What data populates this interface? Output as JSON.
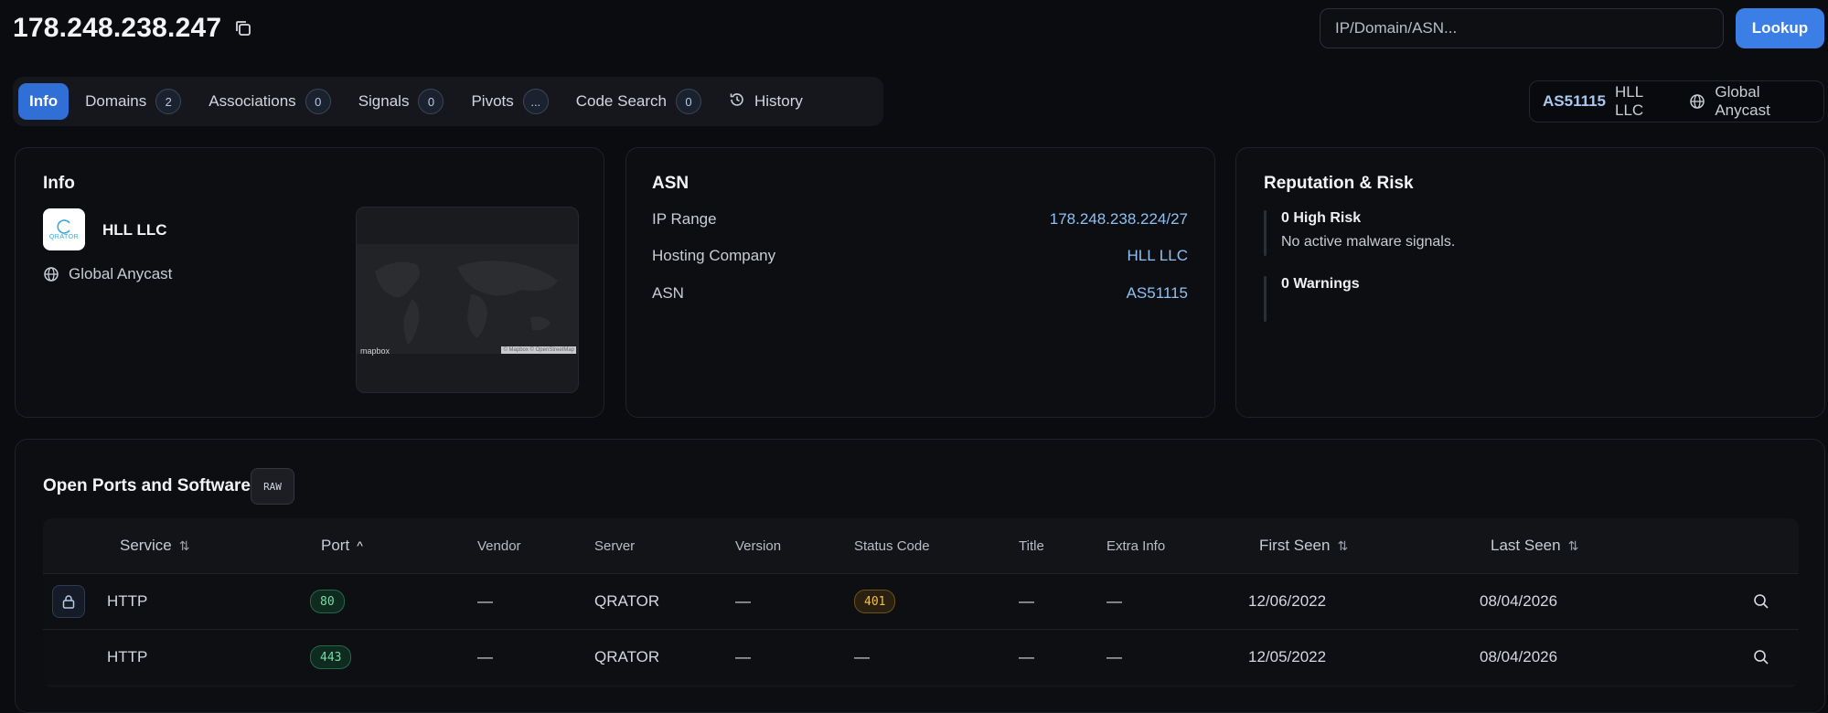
{
  "header": {
    "ip": "178.248.238.247",
    "search_placeholder": "IP/Domain/ASN...",
    "lookup_label": "Lookup"
  },
  "tabs": [
    {
      "label": "Info",
      "badge": null,
      "active": true
    },
    {
      "label": "Domains",
      "badge": "2"
    },
    {
      "label": "Associations",
      "badge": "0"
    },
    {
      "label": "Signals",
      "badge": "0"
    },
    {
      "label": "Pivots",
      "badge": "..."
    },
    {
      "label": "Code Search",
      "badge": "0"
    },
    {
      "label": "History",
      "icon": "history-icon"
    }
  ],
  "asn_chip": {
    "asn": "AS51115",
    "org": "HLL LLC",
    "network": "Global Anycast"
  },
  "info_card": {
    "title": "Info",
    "org": "HLL LLC",
    "logo_text": "QRATOR",
    "network": "Global Anycast",
    "map_credit": "mapbox",
    "map_attribution": "© Mapbox © OpenStreetMap"
  },
  "asn_card": {
    "title": "ASN",
    "rows": [
      {
        "key": "IP Range",
        "value": "178.248.238.224/27"
      },
      {
        "key": "Hosting Company",
        "value": "HLL LLC"
      },
      {
        "key": "ASN",
        "value": "AS51115"
      }
    ]
  },
  "risk_card": {
    "title": "Reputation & Risk",
    "high_risk": "0 High Risk",
    "high_risk_desc": "No active malware signals.",
    "warnings": "0 Warnings"
  },
  "ports": {
    "title": "Open Ports and Software",
    "raw_label": "RAW",
    "columns": {
      "service": "Service",
      "port": "Port",
      "vendor": "Vendor",
      "server": "Server",
      "version": "Version",
      "status_code": "Status Code",
      "title": "Title",
      "extra_info": "Extra Info",
      "first_seen": "First Seen",
      "last_seen": "Last Seen"
    },
    "rows": [
      {
        "service": "HTTP",
        "port": "80",
        "vendor": "—",
        "server": "QRATOR",
        "version": "—",
        "status_code": "401",
        "title": "—",
        "extra_info": "—",
        "first_seen": "12/06/2022",
        "last_seen": "08/04/2026",
        "locked": true
      },
      {
        "service": "HTTP",
        "port": "443",
        "vendor": "—",
        "server": "QRATOR",
        "version": "—",
        "status_code": "—",
        "title": "—",
        "extra_info": "—",
        "first_seen": "12/05/2022",
        "last_seen": "08/04/2026",
        "locked": false
      }
    ]
  },
  "colors": {
    "accent": "#3a7ee6",
    "link": "#8fc0ef",
    "port_green": "#6de0a5",
    "status_amber": "#f0c04a"
  }
}
